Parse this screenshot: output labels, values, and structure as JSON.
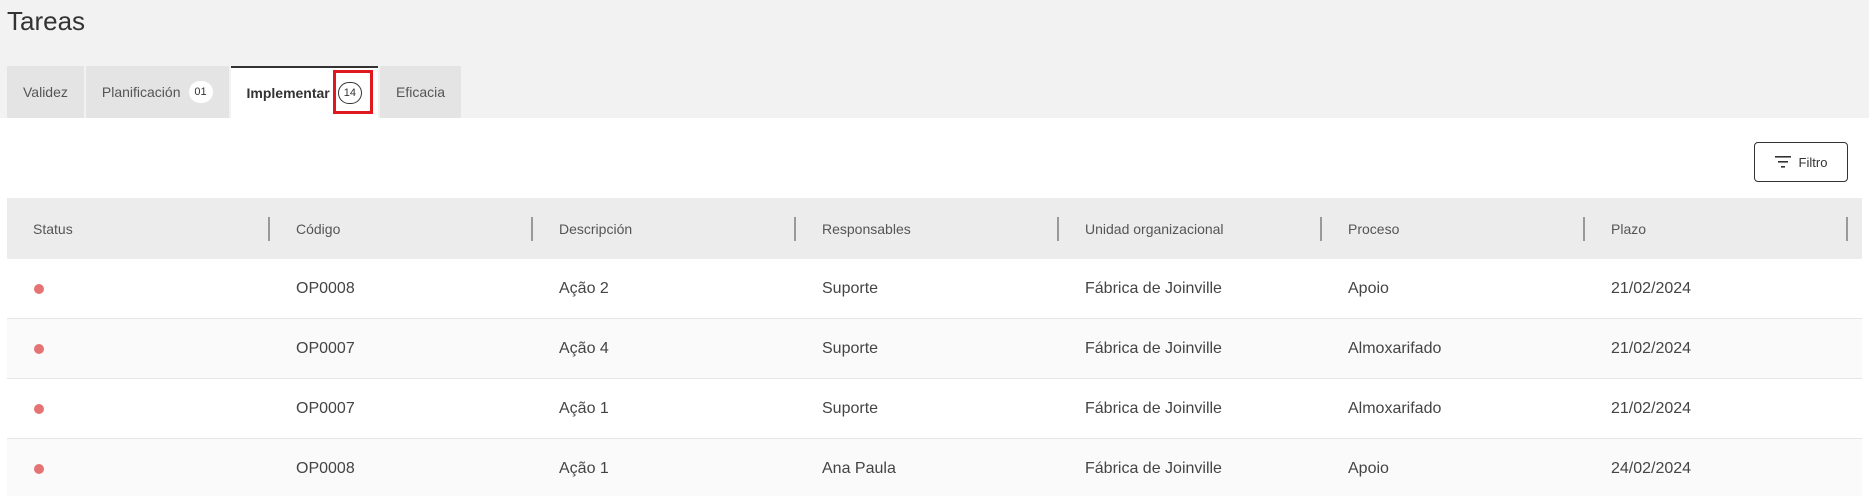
{
  "page": {
    "title": "Tareas"
  },
  "tabs": [
    {
      "label": "Validez",
      "badge": ""
    },
    {
      "label": "Planificación",
      "badge": "01"
    },
    {
      "label": "Implementar",
      "badge": "14",
      "active": true
    },
    {
      "label": "Eficacia",
      "badge": ""
    }
  ],
  "toolbar": {
    "filter_label": "Filtro",
    "filter_icon": "filter-icon"
  },
  "table": {
    "columns": [
      "Status",
      "Código",
      "Descripción",
      "Responsables",
      "Unidad organizacional",
      "Proceso",
      "Plazo"
    ],
    "rows": [
      {
        "status": "red-dot",
        "codigo": "OP0008",
        "descripcion": "Ação 2",
        "responsables": "Suporte",
        "unidad": "Fábrica de Joinville",
        "proceso": "Apoio",
        "plazo": "21/02/2024"
      },
      {
        "status": "red-dot",
        "codigo": "OP0007",
        "descripcion": "Ação 4",
        "responsables": "Suporte",
        "unidad": "Fábrica de Joinville",
        "proceso": "Almoxarifado",
        "plazo": "21/02/2024"
      },
      {
        "status": "red-dot",
        "codigo": "OP0007",
        "descripcion": "Ação 1",
        "responsables": "Suporte",
        "unidad": "Fábrica de Joinville",
        "proceso": "Almoxarifado",
        "plazo": "21/02/2024"
      },
      {
        "status": "red-dot",
        "codigo": "OP0008",
        "descripcion": "Ação 1",
        "responsables": "Ana Paula",
        "unidad": "Fábrica de Joinville",
        "proceso": "Apoio",
        "plazo": "24/02/2024"
      }
    ]
  },
  "colors": {
    "status_dot": "#e57373",
    "highlight": "#e0191f"
  }
}
